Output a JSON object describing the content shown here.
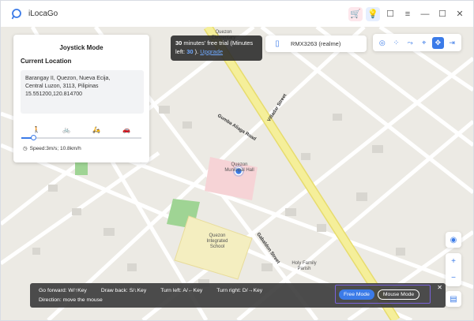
{
  "app": {
    "title": "iLocaGo"
  },
  "colors": {
    "accent": "#3b7be8",
    "highlight": "#7a63d9",
    "map_road_yellow": "#f5ef9a",
    "map_park": "#9fd494",
    "map_poi": "#f6d3d6"
  },
  "titlebar_icons": [
    "cart-icon",
    "bulb-icon",
    "chat-icon",
    "menu-icon",
    "minimize-icon",
    "maximize-icon",
    "close-icon"
  ],
  "joystick_panel": {
    "title": "Joystick Mode",
    "location_label": "Current Location",
    "address_lines": [
      "Barangay II, Quezon, Nueva Ecija,",
      "Central Luzon, 3113, Pilipinas",
      "15.551200,120.814700"
    ],
    "modes": [
      "walk-icon",
      "bike-icon",
      "scooter-icon",
      "car-icon"
    ],
    "speed": "Speed:3m/s; 10.8km/h",
    "speed_level": 0.1
  },
  "trial_banner": {
    "prefix_bold": "30",
    "text1": " minutes' free trial (Minutes left: ",
    "count": "30",
    "text2": " ). ",
    "link": "Upgrade"
  },
  "device": {
    "name": "RMX3263 (realme)"
  },
  "map": {
    "roads": [
      "Gumba Aliaga Road",
      "Villadar Street",
      "Gabaldon Street"
    ],
    "places": [
      "Quezon Municipal Hall",
      "Quezon Integrated School",
      "Holy Family Parish",
      "Quezon Elementary"
    ]
  },
  "bottom_bar": {
    "hints": [
      "Go forward: W/↑Key",
      "Draw back: S/↓Key",
      "Turn left: A/←Key",
      "Turn right: D/→Key"
    ],
    "hint2": "Direction: move the mouse",
    "free_mode": "Free Mode",
    "mouse_mode": "Mouse Mode"
  }
}
